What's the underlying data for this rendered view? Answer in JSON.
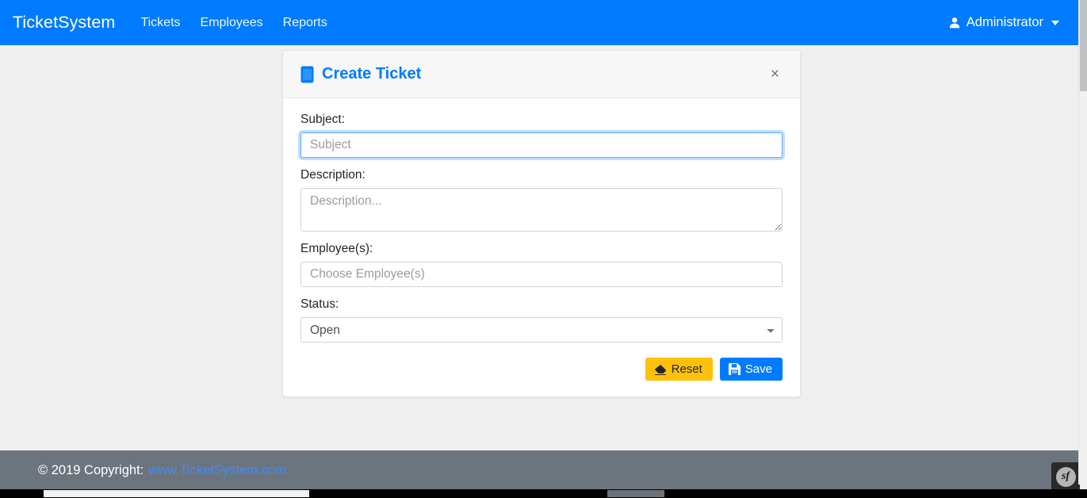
{
  "navbar": {
    "brand": "TicketSystem",
    "links": [
      {
        "label": "Tickets",
        "name": "nav-link-tickets"
      },
      {
        "label": "Employees",
        "name": "nav-link-employees"
      },
      {
        "label": "Reports",
        "name": "nav-link-reports"
      }
    ],
    "user": {
      "label": "Administrator",
      "icon": "user-icon",
      "caret": "chevron-down-icon"
    },
    "background_color": "#007bff"
  },
  "card": {
    "title": "Create Ticket",
    "title_icon": "ticket-icon",
    "title_color": "#007bff",
    "close_label": "×",
    "fields": {
      "subject": {
        "label": "Subject:",
        "placeholder": "Subject",
        "value": "",
        "focused": true
      },
      "description": {
        "label": "Description:",
        "placeholder": "Description...",
        "value": ""
      },
      "employees": {
        "label": "Employee(s):",
        "placeholder": "Choose Employee(s)",
        "value": ""
      },
      "status": {
        "label": "Status:",
        "selected": "Open",
        "options": [
          "Open"
        ]
      }
    },
    "buttons": {
      "reset": {
        "label": "Reset",
        "icon": "eraser-icon",
        "color": "#ffc107"
      },
      "save": {
        "label": "Save",
        "icon": "save-icon",
        "color": "#007bff"
      }
    }
  },
  "footer": {
    "text": "© 2019 Copyright:",
    "link": "www.TicketSystem.com",
    "link_color": "#3d8bfd",
    "background_color": "#6c757d"
  },
  "debug_toolbar": {
    "badge": "sf"
  }
}
